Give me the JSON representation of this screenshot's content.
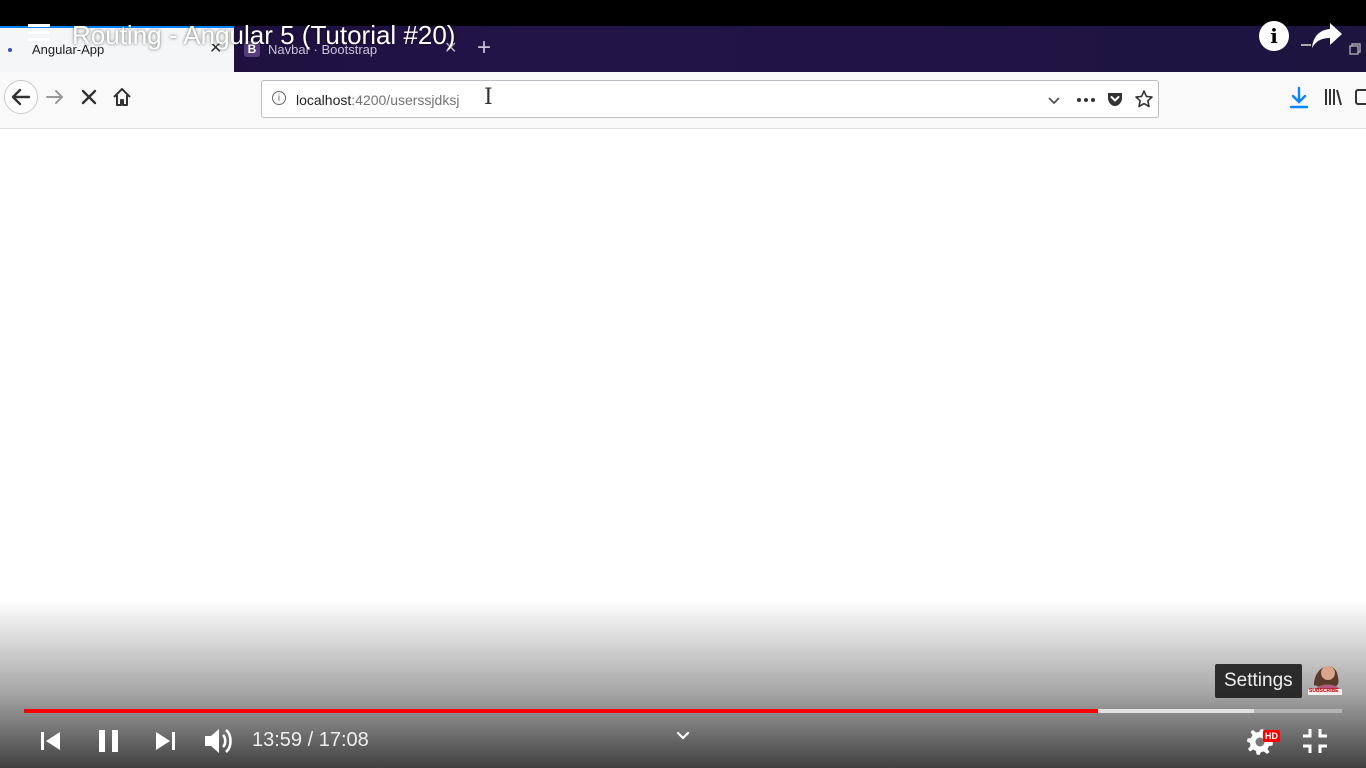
{
  "video": {
    "title": "Routing - Angular 5 (Tutorial #20)",
    "current_time": "13:59",
    "duration": "17:08",
    "time_display": "13:59 / 17:08",
    "progress_played": 0.815,
    "progress_buffered": 0.933,
    "settings_tooltip": "Settings",
    "hd_badge": "HD",
    "watermark_text": "SUBSCRIBE"
  },
  "browser": {
    "tabs": [
      {
        "label": "Angular-App",
        "active": true
      },
      {
        "label": "Navbar · Bootstrap",
        "active": false,
        "favicon": "B"
      }
    ],
    "url": {
      "host": "localhost",
      "path": ":4200/userssjdksj"
    }
  },
  "icons": {
    "menu": "hamburger-menu-icon",
    "info": "info-icon",
    "share": "share-arrow-icon",
    "prev": "skip-previous-icon",
    "pause": "pause-icon",
    "next": "skip-next-icon",
    "volume": "volume-icon",
    "settings": "gear-icon",
    "exit_fullscreen": "exit-fullscreen-icon"
  },
  "colors": {
    "progress_played": "#ff0000",
    "tab_accent": "#0a84ff",
    "tabstrip": "#1d1440",
    "download_icon": "#0a84ff"
  }
}
